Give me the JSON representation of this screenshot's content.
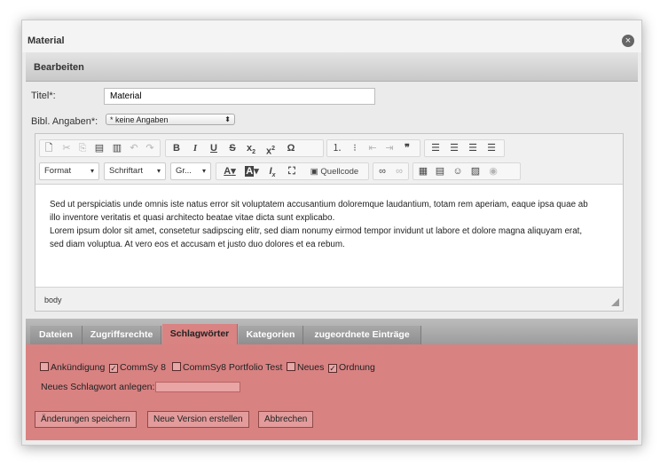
{
  "dialog": {
    "title": "Material",
    "close_icon": "×",
    "section_title": "Bearbeiten"
  },
  "form": {
    "title_label": "Titel*:",
    "title_value": "Material",
    "bibl_label": "Bibl. Angaben*:",
    "bibl_selected": "* keine Angaben"
  },
  "editor": {
    "toolbar_row1": [
      "⌕",
      "✂",
      "⎘",
      "📋",
      "📋",
      "↶",
      "↷",
      "B",
      "I",
      "U",
      "S",
      "x₂",
      "x²",
      "Ω",
      "⋮≡",
      "•≡",
      "⇤",
      "⇥",
      "❞",
      "≡",
      "≡",
      "≡",
      "≡"
    ],
    "format_label": "Format",
    "font_label": "Schriftart",
    "size_label": "Gr...",
    "text_color": "A",
    "bg_color": "A",
    "remove_format": "Ix",
    "maximize": "⛶",
    "source_label": "Quellcode",
    "paragraph1_line1": "Sed ut perspiciatis unde omnis iste natus error sit voluptatem accusantium doloremque laudantium, totam rem aperiam, eaque ipsa quae ab",
    "paragraph1_line2": "illo inventore veritatis et quasi architecto beatae vitae dicta sunt explicabo.",
    "paragraph2_line1": "Lorem ipsum dolor sit amet, consetetur sadipscing elitr, sed diam nonumy eirmod tempor invidunt ut labore et dolore magna aliquyam erat,",
    "paragraph2_line2": "sed diam voluptua. At vero eos et accusam et justo duo dolores et ea rebum.",
    "path": "body"
  },
  "tabs": [
    {
      "label": "Dateien",
      "active": false
    },
    {
      "label": "Zugriffsrechte",
      "active": false
    },
    {
      "label": "Schlagwörter",
      "active": true
    },
    {
      "label": "Kategorien",
      "active": false
    },
    {
      "label": "zugeordnete Einträge",
      "active": false
    }
  ],
  "keywords": {
    "items": [
      {
        "label": "Ankündigung",
        "checked": false
      },
      {
        "label": "CommSy 8",
        "checked": true
      },
      {
        "label": "CommSy8 Portfolio Test",
        "checked": false
      },
      {
        "label": "Neues",
        "checked": false
      },
      {
        "label": "Ordnung",
        "checked": true
      }
    ],
    "new_label": "Neues Schlagwort anlegen:"
  },
  "buttons": {
    "save": "Änderungen speichern",
    "new_version": "Neue Version erstellen",
    "cancel": "Abbrechen"
  },
  "colors": {
    "panel": "#d98282",
    "button": "#e39b9b"
  }
}
